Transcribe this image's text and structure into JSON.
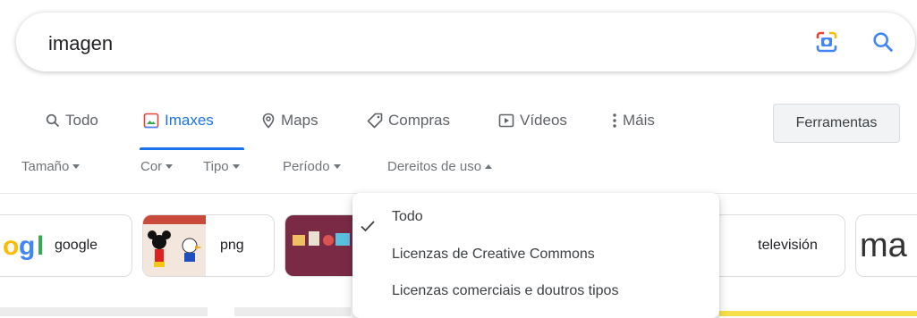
{
  "search": {
    "query": "imagen"
  },
  "tabs": [
    {
      "label": "Todo",
      "icon": "search-icon"
    },
    {
      "label": "Imaxes",
      "icon": "image-icon",
      "active": true
    },
    {
      "label": "Maps",
      "icon": "location-pin-icon"
    },
    {
      "label": "Compras",
      "icon": "tag-icon"
    },
    {
      "label": "Vídeos",
      "icon": "play-icon"
    },
    {
      "label": "Máis",
      "icon": "more-vert-icon"
    }
  ],
  "tools_label": "Ferramentas",
  "filters": [
    {
      "label": "Tamaño"
    },
    {
      "label": "Cor"
    },
    {
      "label": "Tipo"
    },
    {
      "label": "Período"
    },
    {
      "label": "Dereitos de uso",
      "open": true
    }
  ],
  "chips": [
    {
      "label": "google"
    },
    {
      "label": "png"
    },
    {
      "label": ""
    },
    {
      "label": "televisión"
    },
    {
      "label": "ma"
    }
  ],
  "usage_menu": {
    "items": [
      {
        "label": "Todo",
        "selected": true
      },
      {
        "label": "Licenzas de Creative Commons"
      },
      {
        "label": "Licenzas comerciais e doutros tipos"
      }
    ]
  },
  "colors": {
    "accent": "#1a73e8",
    "muted": "#5f6368"
  }
}
